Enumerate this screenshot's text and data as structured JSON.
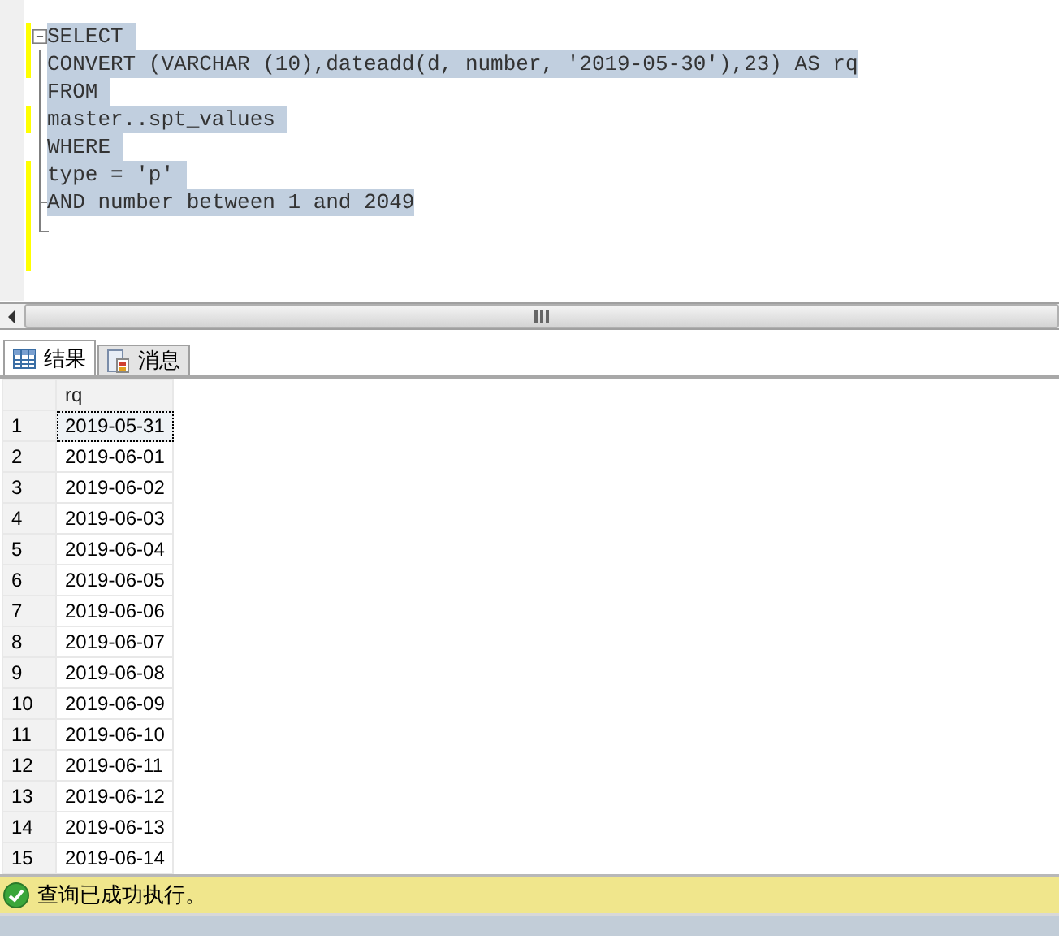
{
  "editor": {
    "lines": [
      {
        "text": "SELECT ",
        "selected": true,
        "changed": true,
        "kind": "fold-start"
      },
      {
        "text": "CONVERT (VARCHAR (10),dateadd(d, number, '2019-05-30'),23) AS rq",
        "selected": true,
        "changed": true,
        "kind": "line"
      },
      {
        "text": "FROM ",
        "selected": true,
        "changed": false,
        "kind": "line"
      },
      {
        "text": "master..spt_values ",
        "selected": true,
        "changed": true,
        "kind": "line"
      },
      {
        "text": "WHERE ",
        "selected": true,
        "changed": false,
        "kind": "line"
      },
      {
        "text": "type = 'p' ",
        "selected": true,
        "changed": true,
        "kind": "line"
      },
      {
        "text": "AND number between 1 and 2049",
        "selected": true,
        "changed": true,
        "kind": "fold-end"
      }
    ]
  },
  "tabs": [
    {
      "label": "结果",
      "kind": "grid",
      "selected": true
    },
    {
      "label": "消息",
      "kind": "messages",
      "selected": false
    }
  ],
  "grid": {
    "columns": [
      "rq"
    ],
    "rows": [
      {
        "num": "1",
        "value": "2019-05-31",
        "selected": true
      },
      {
        "num": "2",
        "value": "2019-06-01",
        "selected": false
      },
      {
        "num": "3",
        "value": "2019-06-02",
        "selected": false
      },
      {
        "num": "4",
        "value": "2019-06-03",
        "selected": false
      },
      {
        "num": "5",
        "value": "2019-06-04",
        "selected": false
      },
      {
        "num": "6",
        "value": "2019-06-05",
        "selected": false
      },
      {
        "num": "7",
        "value": "2019-06-06",
        "selected": false
      },
      {
        "num": "8",
        "value": "2019-06-07",
        "selected": false
      },
      {
        "num": "9",
        "value": "2019-06-08",
        "selected": false
      },
      {
        "num": "10",
        "value": "2019-06-09",
        "selected": false
      },
      {
        "num": "11",
        "value": "2019-06-10",
        "selected": false
      },
      {
        "num": "12",
        "value": "2019-06-11",
        "selected": false
      },
      {
        "num": "13",
        "value": "2019-06-12",
        "selected": false
      },
      {
        "num": "14",
        "value": "2019-06-13",
        "selected": false
      },
      {
        "num": "15",
        "value": "2019-06-14",
        "selected": false
      }
    ]
  },
  "status_bar": {
    "text": "查询已成功执行。",
    "kind": "success"
  }
}
